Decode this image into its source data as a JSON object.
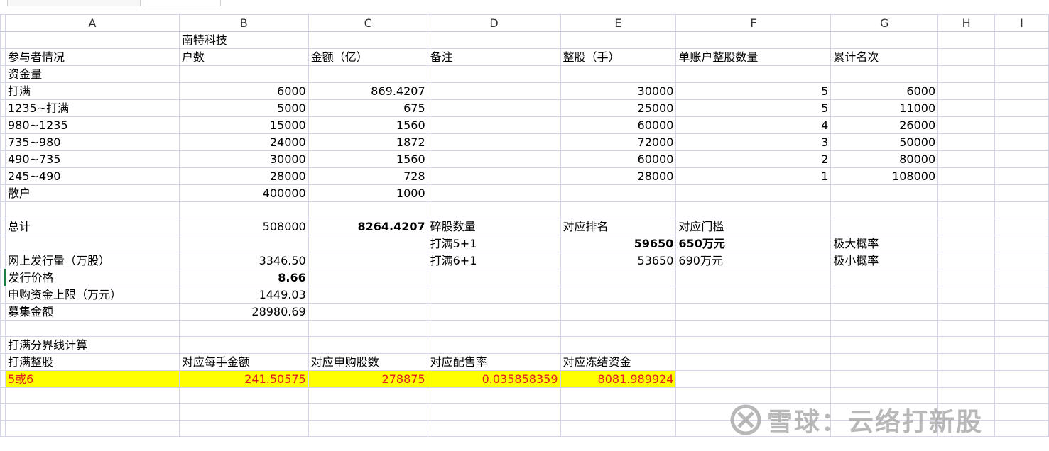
{
  "columns": [
    "A",
    "B",
    "C",
    "D",
    "E",
    "F",
    "G",
    "H",
    "I"
  ],
  "rows": [
    [
      "",
      "南特科技",
      "",
      "",
      "",
      "",
      ""
    ],
    [
      "参与者情况",
      "户数",
      "金额（亿）",
      "备注",
      "整股（手）",
      "单账户整股数量",
      "累计名次"
    ],
    [
      "资金量",
      "",
      "",
      "",
      "",
      "",
      ""
    ],
    [
      "打满",
      "6000",
      "869.4207",
      "",
      "30000",
      "5",
      "6000"
    ],
    [
      "1235~打满",
      "5000",
      "675",
      "",
      "25000",
      "5",
      "11000"
    ],
    [
      "980~1235",
      "15000",
      "1560",
      "",
      "60000",
      "4",
      "26000"
    ],
    [
      "735~980",
      "24000",
      "1872",
      "",
      "72000",
      "3",
      "50000"
    ],
    [
      "490~735",
      "30000",
      "1560",
      "",
      "60000",
      "2",
      "80000"
    ],
    [
      "245~490",
      "28000",
      "728",
      "",
      "28000",
      "1",
      "108000"
    ],
    [
      "散户",
      "400000",
      "1000",
      "",
      "",
      "",
      ""
    ],
    [
      "",
      "",
      "",
      "",
      "",
      "",
      ""
    ],
    [
      "总计",
      "508000",
      "8264.4207",
      "碎股数量",
      "对应排名",
      "对应门槛",
      ""
    ],
    [
      "",
      "",
      "",
      "打满5+1",
      "59650",
      "650万元",
      "极大概率"
    ],
    [
      "网上发行量（万股）",
      "3346.50",
      "",
      "打满6+1",
      "53650",
      "690万元",
      "极小概率"
    ],
    [
      "发行价格",
      "8.66",
      "",
      "",
      "",
      "",
      ""
    ],
    [
      "申购资金上限（万元）",
      "1449.03",
      "",
      "",
      "",
      "",
      ""
    ],
    [
      "募集金额",
      "28980.69",
      "",
      "",
      "",
      "",
      ""
    ],
    [
      "",
      "",
      "",
      "",
      "",
      "",
      ""
    ],
    [
      "打满分界线计算",
      "",
      "",
      "",
      "",
      "",
      ""
    ],
    [
      "打满整股",
      "对应每手金额",
      "对应申购股数",
      "对应配售率",
      "对应冻结资金",
      "",
      ""
    ],
    [
      "5或6",
      "241.50575",
      "278875",
      "0.035858359",
      "8081.989924",
      "",
      ""
    ],
    [
      "",
      "",
      "",
      "",
      "",
      "",
      ""
    ],
    [
      "",
      "",
      "",
      "",
      "",
      "",
      ""
    ],
    [
      "",
      "",
      "",
      "",
      "",
      "",
      ""
    ]
  ],
  "watermark": "雪球：云络打新股",
  "colors": {
    "highlight_bg": "#ffff00",
    "highlight_text": "#e02020",
    "grid_line": "#d4d4e8"
  }
}
